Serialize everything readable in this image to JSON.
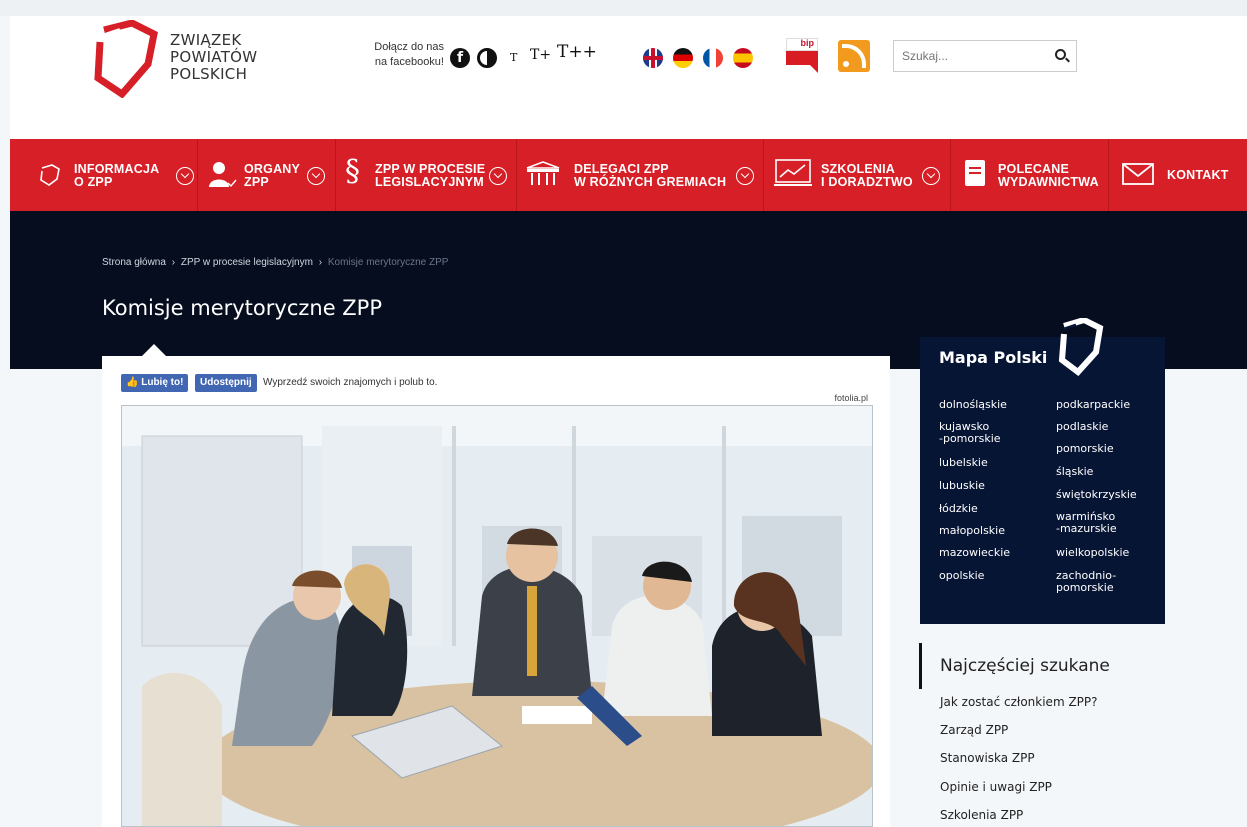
{
  "header": {
    "logo_lines": [
      "ZWIĄZEK",
      "POWIATÓW",
      "POLSKICH"
    ],
    "facebook_join": [
      "Dołącz do nas",
      "na facebooku!"
    ],
    "font_sizes": [
      "T",
      "T+",
      "T++"
    ],
    "icons": [
      "facebook-icon",
      "contrast-icon",
      "flag-en-icon",
      "flag-de-icon",
      "flag-fr-icon",
      "flag-es-icon",
      "bip-icon",
      "rss-icon",
      "search-icon"
    ],
    "bip_label": "bip",
    "search_placeholder": "Szukaj..."
  },
  "nav": {
    "items": [
      {
        "line1": "INFORMACJA",
        "line2": "O ZPP",
        "icon": "logo-outline-icon"
      },
      {
        "line1": "ORGANY",
        "line2": "ZPP",
        "icon": "user-check-icon"
      },
      {
        "line1": "ZPP W PROCESIE",
        "line2": "LEGISLACYJNYM",
        "icon": "paragraph-icon"
      },
      {
        "line1": "DELEGACI ZPP",
        "line2": "W RÓŻNYCH GREMIACH",
        "icon": "building-icon"
      },
      {
        "line1": "SZKOLENIA",
        "line2": "I DORADZTWO",
        "icon": "chart-screen-icon"
      },
      {
        "line1": "POLECANE",
        "line2": "WYDAWNICTWA",
        "icon": "document-icon"
      },
      {
        "line1": "KONTAKT",
        "line2": "",
        "icon": "envelope-icon"
      }
    ]
  },
  "breadcrumb": {
    "home": "Strona główna",
    "separator": "›",
    "parent": "ZPP w procesie legislacyjnym",
    "current": "Komisje merytoryczne ZPP"
  },
  "page_title": "Komisje merytoryczne ZPP",
  "facebook": {
    "like_label": "Lubię to!",
    "share_label": "Udostępnij",
    "prompt": "Wyprzedź swoich znajomych i polub to."
  },
  "image_credit": "fotolia.pl",
  "map": {
    "title": "Mapa Polski",
    "left_regions": [
      "dolnośląskie",
      "kujawsko",
      "-pomorskie",
      "lubelskie",
      "lubuskie",
      "łódzkie",
      "małopolskie",
      "mazowieckie",
      "opolskie"
    ],
    "right_regions": [
      "podkarpackie",
      "podlaskie",
      "pomorskie",
      "śląskie",
      "świętokrzyskie",
      "warmińsko",
      "-mazurskie",
      "wielkopolskie",
      "zachodnio-",
      "pomorskie"
    ]
  },
  "searched": {
    "title": "Najczęściej szukane",
    "links": [
      "Jak zostać członkiem ZPP?",
      "Zarząd ZPP",
      "Stanowiska ZPP",
      "Opinie i uwagi ZPP",
      "Szkolenia ZPP"
    ]
  },
  "colors": {
    "brand_red": "#d61f26",
    "dark_navy": "#071535",
    "hero_bg": "#060d1f",
    "facebook_blue": "#4267b2"
  }
}
